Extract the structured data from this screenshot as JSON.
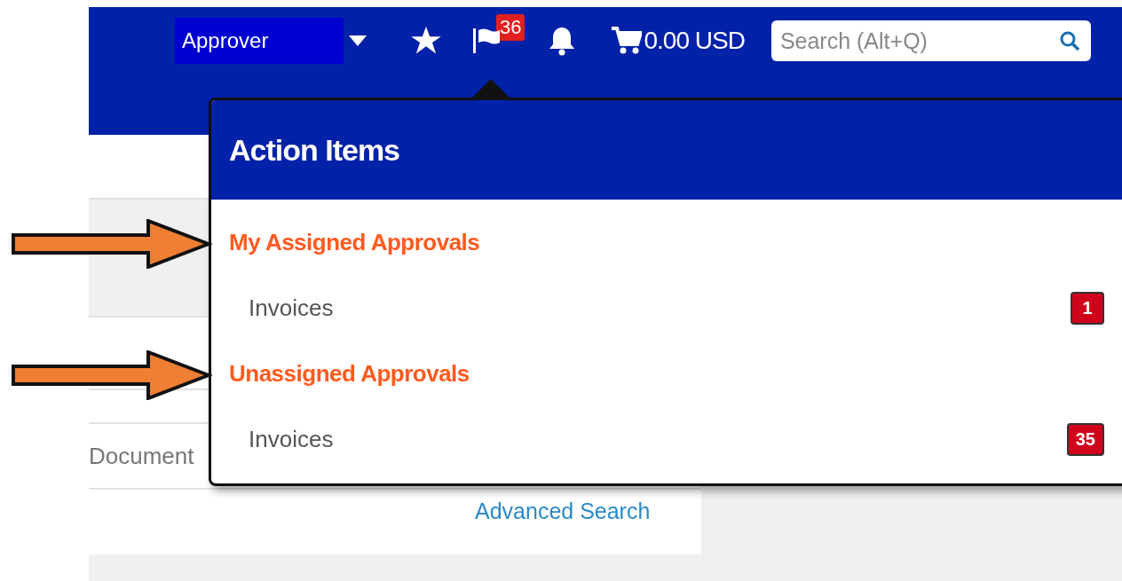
{
  "header": {
    "role_select": "Approver",
    "flag_count": "36",
    "cart_total": "0.00 USD",
    "search": {
      "placeholder": "Search (Alt+Q)"
    }
  },
  "page": {
    "document_label": "Document",
    "advanced_search_link": "Advanced Search"
  },
  "action_items": {
    "title": "Action Items",
    "sections": [
      {
        "heading": "My Assigned Approvals",
        "arrow": true,
        "items": [
          {
            "label": "Invoices",
            "count": "1"
          }
        ]
      },
      {
        "heading": "Unassigned Approvals",
        "arrow": true,
        "items": [
          {
            "label": "Invoices",
            "count": "35"
          }
        ]
      }
    ]
  }
}
